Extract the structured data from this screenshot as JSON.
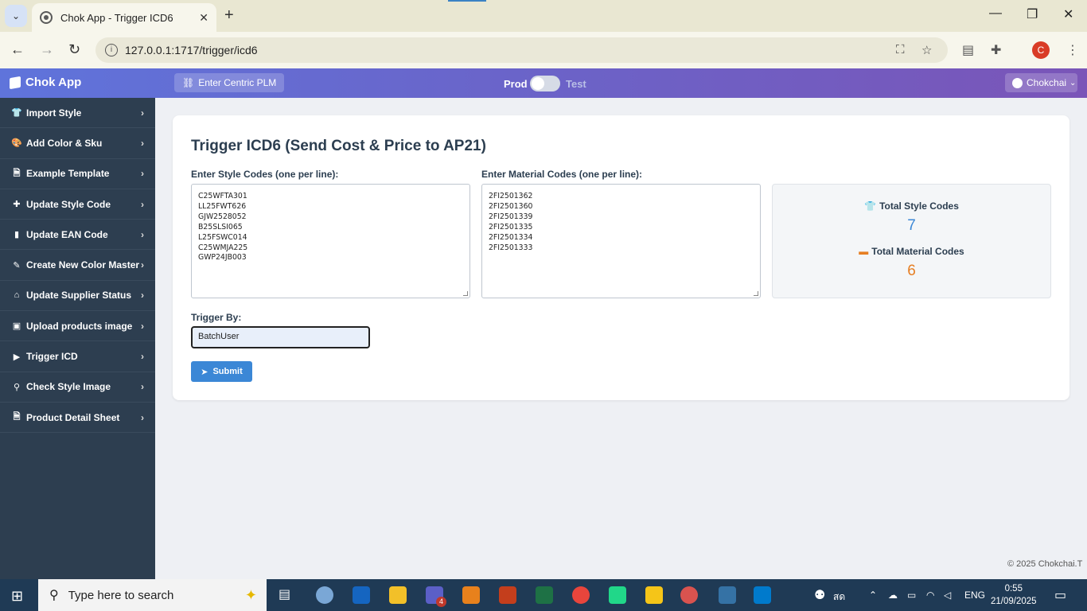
{
  "browser": {
    "tab_title": "Chok App - Trigger ICD6",
    "url": "127.0.0.1:1717/trigger/icd6",
    "profile_initial": "C"
  },
  "header": {
    "logo": "Chok App",
    "centric_button": "Enter Centric PLM",
    "env_prod": "Prod",
    "env_test": "Test",
    "user": "Chokchai"
  },
  "sidebar": {
    "items": [
      {
        "label": "Import Style",
        "icon": "shirt-icon",
        "glyph": "👕"
      },
      {
        "label": "Add Color & Sku",
        "icon": "palette-icon",
        "glyph": "🎨"
      },
      {
        "label": "Example Template",
        "icon": "file-icon",
        "glyph": "🗎"
      },
      {
        "label": "Update Style Code",
        "icon": "puzzle-icon",
        "glyph": "✚"
      },
      {
        "label": "Update EAN Code",
        "icon": "barcode-icon",
        "glyph": "▮"
      },
      {
        "label": "Create New Color Master",
        "icon": "brush-icon",
        "glyph": "✎"
      },
      {
        "label": "Update Supplier Status",
        "icon": "bank-icon",
        "glyph": "⌂"
      },
      {
        "label": "Upload products image",
        "icon": "image-icon",
        "glyph": "▣"
      },
      {
        "label": "Trigger ICD",
        "icon": "play-icon",
        "glyph": "▶"
      },
      {
        "label": "Check Style Image",
        "icon": "search-icon",
        "glyph": "⚲"
      },
      {
        "label": "Product Detail Sheet",
        "icon": "document-icon",
        "glyph": "🗎"
      }
    ]
  },
  "main": {
    "title": "Trigger ICD6 (Send Cost & Price to AP21)",
    "style_label": "Enter Style Codes (one per line):",
    "style_codes": "C25WFTA301\nLL25FWT626\nGJW2528052\nB25SLSI065\nL25FSWC014\nC25WMJA225\nGWP24JB003",
    "material_label": "Enter Material Codes (one per line):",
    "material_codes": "2FI2501362\n2FI2501360\n2FI2501339\n2FI2501335\n2FI2501334\n2FI2501333",
    "total_style_label": "Total Style Codes",
    "total_style_value": "7",
    "total_material_label": "Total Material Codes",
    "total_material_value": "6",
    "trigger_by_label": "Trigger By:",
    "trigger_by_value": "BatchUser",
    "submit_label": "Submit",
    "colors": {
      "style_stat": "#3b87d6",
      "material_stat": "#e67e22",
      "submit": "#3b87d6"
    }
  },
  "footer": "© 2025 Chokchai.T",
  "taskbar": {
    "search_placeholder": "Type here to search",
    "teams_badge": "4",
    "thai_label": "สด",
    "lang": "ENG",
    "time": "0:55",
    "date": "21/09/2025"
  }
}
